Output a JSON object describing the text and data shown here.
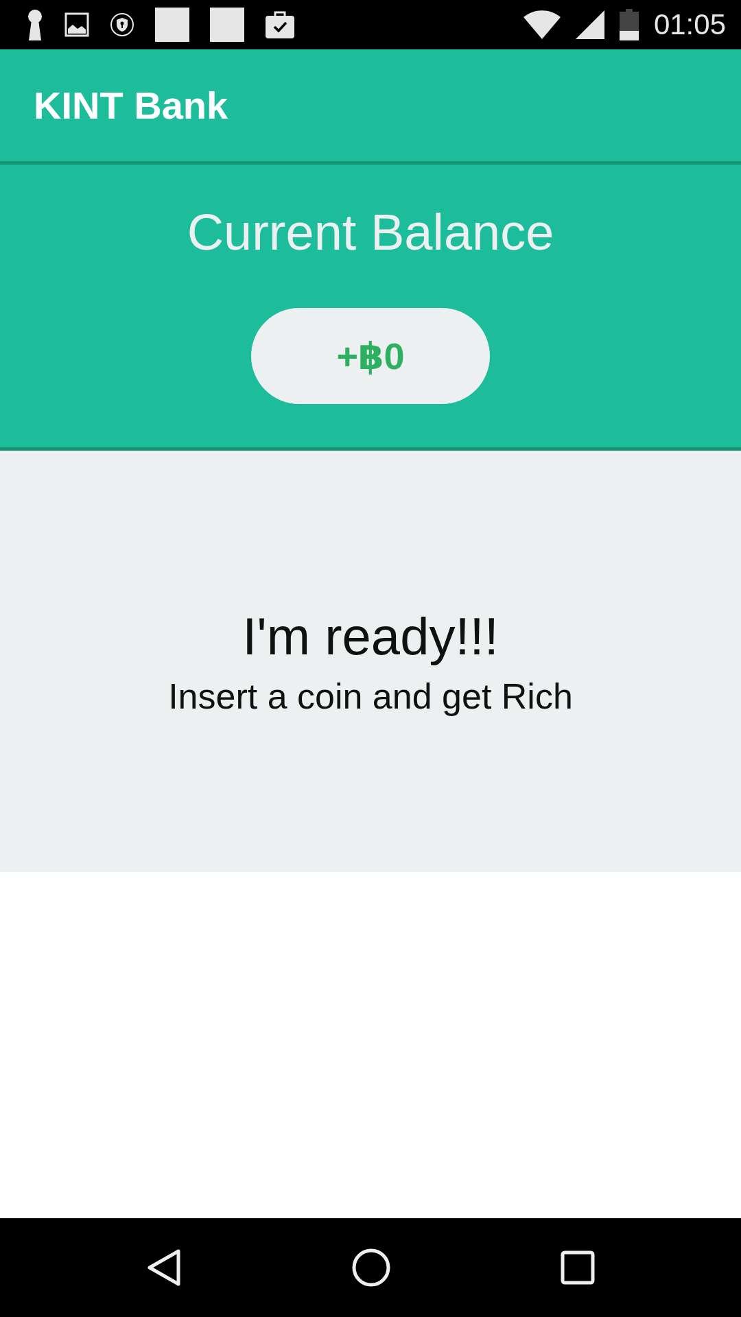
{
  "status_bar": {
    "time": "01:05"
  },
  "app_bar": {
    "title": "KINT Bank"
  },
  "balance": {
    "label": "Current Balance",
    "amount": "+฿0"
  },
  "message": {
    "title": "I'm ready!!!",
    "subtitle": "Insert a coin and get Rich"
  }
}
